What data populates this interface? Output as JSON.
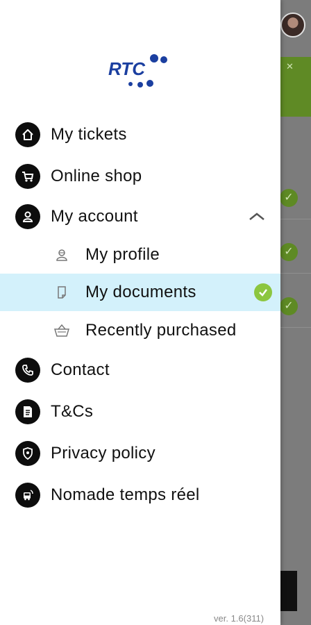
{
  "menu": {
    "my_tickets": "My tickets",
    "online_shop": "Online shop",
    "my_account": "My account",
    "account_sub": {
      "my_profile": "My profile",
      "my_documents": "My documents",
      "recently_purchased": "Recently purchased"
    },
    "contact": "Contact",
    "tcs": "T&Cs",
    "privacy_policy": "Privacy policy",
    "nomade": "Nomade temps réel"
  },
  "logo_text": "RTC",
  "version": "ver. 1.6(311)",
  "colors": {
    "active_row": "#d3f1fb",
    "check_green": "#8cc63f",
    "logo_blue": "#1b3fa0",
    "scrim": "#7c7c7c"
  },
  "icons": {
    "my_tickets": "home-icon",
    "online_shop": "cart-icon",
    "my_account": "person-icon",
    "my_profile": "profile-icon",
    "my_documents": "document-icon",
    "recently_purchased": "basket-icon",
    "contact": "phone-icon",
    "tcs": "terms-icon",
    "privacy_policy": "shield-icon",
    "nomade": "bus-icon"
  }
}
